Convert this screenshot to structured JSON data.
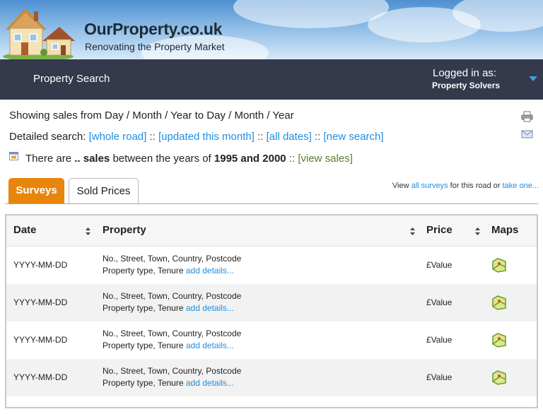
{
  "header": {
    "brand": "OurProperty.co.uk",
    "tagline": "Renovating the Property Market"
  },
  "nav": {
    "title": "Property Search",
    "logged_in_label": "Logged in as:",
    "user": "Property Solvers"
  },
  "info": {
    "showing": "Showing sales from Day / Month / Year to Day / Month / Year",
    "detailed_label": "Detailed search:",
    "links": [
      "[whole road]",
      "[updated this month]",
      "[all dates]",
      "[new search]"
    ],
    "separator": "::",
    "sales_prefix": "There are",
    "sales_count": "..",
    "sales_word": "sales",
    "between": "between the years of",
    "years": "1995 and 2000",
    "view_sales": "[view sales]"
  },
  "tabs": [
    {
      "label": "Surveys",
      "active": false
    },
    {
      "label": "Sold Prices",
      "active": true
    }
  ],
  "view_note": {
    "prefix": "View",
    "link1": "all surveys",
    "middle": "for this road or",
    "link2": "take one..."
  },
  "table": {
    "columns": [
      "Date",
      "Property",
      "Price",
      "Maps"
    ],
    "rows": [
      {
        "date": "YYYY-MM-DD",
        "address": "No., Street, Town, Country, Postcode",
        "type": "Property type, Tenure",
        "add": "add details...",
        "price": "£Value"
      },
      {
        "date": "YYYY-MM-DD",
        "address": "No., Street, Town, Country, Postcode",
        "type": "Property type, Tenure",
        "add": "add details...",
        "price": "£Value"
      },
      {
        "date": "YYYY-MM-DD",
        "address": "No., Street, Town, Country, Postcode",
        "type": "Property type, Tenure",
        "add": "add details...",
        "price": "£Value"
      },
      {
        "date": "YYYY-MM-DD",
        "address": "No., Street, Town, Country, Postcode",
        "type": "Property type, Tenure",
        "add": "add details...",
        "price": "£Value"
      }
    ]
  },
  "icons": {
    "logo": "houses-logo-icon",
    "calendar": "calendar-icon",
    "print": "print-icon",
    "email": "email-icon",
    "map": "map-icon",
    "sort": "sort-icon",
    "dropdown": "chevron-down-icon"
  },
  "colors": {
    "nav_bg": "#343a4b",
    "link": "#1e8ee0",
    "active_tab": "#e8850d",
    "sales_link": "#5a7d2a"
  }
}
